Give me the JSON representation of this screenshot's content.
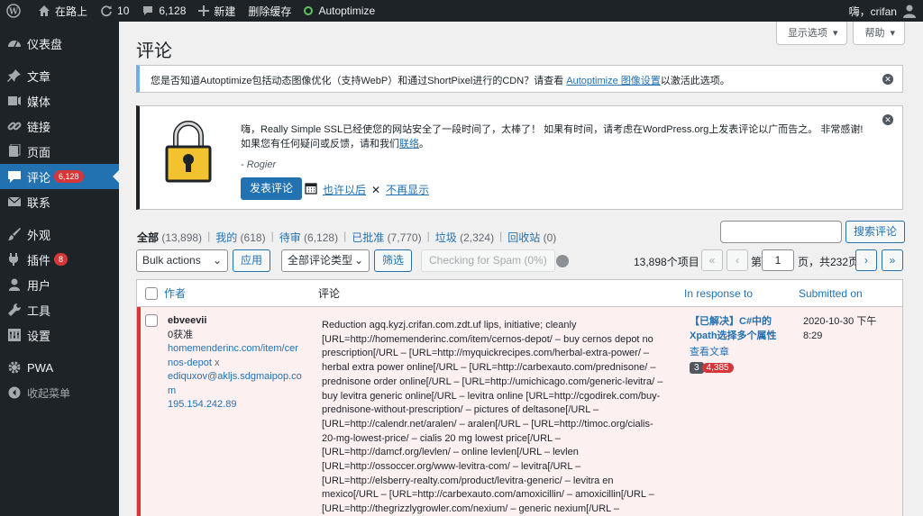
{
  "adminbar": {
    "site_name": "在路上",
    "updates_count": "10",
    "comments_count": "6,128",
    "new_label": "新建",
    "clear_cache": "删除缓存",
    "autoptimize": "Autoptimize",
    "greeting": "嗨，crifan"
  },
  "sidebar": {
    "items": [
      {
        "label": "仪表盘",
        "icon": "dashboard-icon"
      },
      {
        "label": "文章",
        "icon": "pin-icon"
      },
      {
        "label": "媒体",
        "icon": "media-icon"
      },
      {
        "label": "链接",
        "icon": "link-icon"
      },
      {
        "label": "页面",
        "icon": "page-icon"
      },
      {
        "label": "评论",
        "icon": "comment-icon",
        "badge": "6,128"
      },
      {
        "label": "联系",
        "icon": "mail-icon"
      },
      {
        "label": "外观",
        "icon": "brush-icon"
      },
      {
        "label": "插件",
        "icon": "plugin-icon",
        "badge": "8"
      },
      {
        "label": "用户",
        "icon": "user-icon"
      },
      {
        "label": "工具",
        "icon": "wrench-icon"
      },
      {
        "label": "设置",
        "icon": "settings-icon"
      },
      {
        "label": "PWA",
        "icon": "gear-icon"
      },
      {
        "label": "收起菜单",
        "icon": "collapse-icon"
      }
    ]
  },
  "screen_meta": {
    "options": "显示选项",
    "help": "帮助"
  },
  "page_title": "评论",
  "ao_notice": {
    "text_before": "您是否知道Autoptimize包括动态图像优化（支持WebP）和通过ShortPixel进行的CDN？请查看 ",
    "link": "Autoptimize 图像设置",
    "text_after": "以激活此选项。"
  },
  "rsssl_notice": {
    "line1": "嗨，Really Simple SSL已经使您的网站安全了一段时间了，太棒了！ 如果有时间，请考虑在WordPress.org上发表评论以广而告之。 非常感谢!",
    "line2_before": "如果您有任何疑问或反馈，请和我们",
    "line2_link": "联络",
    "line2_after": "。",
    "signature": "- Rogier",
    "btn_review": "发表评论",
    "link_later": "也许以后",
    "link_never": "不再显示"
  },
  "filters": {
    "all": "全部",
    "all_count": "(13,898)",
    "mine": "我的",
    "mine_count": "(618)",
    "pending": "待审",
    "pending_count": "(6,128)",
    "approved": "已批准",
    "approved_count": "(7,770)",
    "spam": "垃圾",
    "spam_count": "(2,324)",
    "trash": "回收站",
    "trash_count": "(0)"
  },
  "search": {
    "button": "搜索评论",
    "value": ""
  },
  "tablenav": {
    "bulk_actions": "Bulk actions",
    "apply": "应用",
    "comment_type": "全部评论类型",
    "filter": "筛选",
    "check_spam": "Checking for Spam (0%)",
    "items_count": "13,898个项目",
    "first": "«",
    "prev": "‹",
    "page_prefix": "第",
    "current_page": "1",
    "page_suffix": "页，共232页",
    "next": "›",
    "last": "»"
  },
  "table": {
    "headers": {
      "author": "作者",
      "comment": "评论",
      "in_response": "In response to",
      "submitted": "Submitted on"
    },
    "rows": [
      {
        "author_name": "ebveevii",
        "author_status": "0获准",
        "author_url": "homemenderinc.com/item/cernos-depot",
        "author_url_line1": "homemenderinc.com/item/cer",
        "author_url_line2": "nos-depot",
        "author_remove": "x",
        "author_email_line1": "ediquxov@akljs.sdgmaipop.co",
        "author_email_line2": "m",
        "author_ip": "195.154.242.89",
        "comment_lines": [
          "Reduction agq.kyzj.crifan.com.zdt.uf lips, initiative; cleanly",
          "[URL=http://homemenderinc.com/item/cernos-depot/ – buy cernos depot no",
          "prescription[/URL – [URL=http://myquickrecipes.com/herbal-extra-power/ –",
          "herbal extra power online[/URL – [URL=http://carbexauto.com/prednisone/ –",
          "prednisone order online[/URL – [URL=http://umichicago.com/generic-levitra/ –",
          "buy levitra generic online[/URL – levitra online [URL=http://cgodirek.com/buy-",
          "prednisone-without-prescription/ – pictures of deltasone[/URL –",
          "[URL=http://calendr.net/aralen/ – aralen[/URL – [URL=http://timoc.org/cialis-",
          "20-mg-lowest-price/ – cialis 20 mg lowest price[/URL –",
          "[URL=http://damcf.org/levlen/ – online levlen[/URL – levlen",
          "[URL=http://ossoccer.org/www-levitra-com/ – levitra[/URL –",
          "[URL=http://elsberry-realty.com/product/levitra-generic/ – levitra en",
          "mexico[/URL – [URL=http://carbexauto.com/amoxicillin/ – amoxicillin[/URL –",
          "[URL=http://thegrizzlygrowler.com/nexium/ – generic nexium[/URL –"
        ],
        "response_title_line1": "【已解决】C#中的",
        "response_title_line2": "Xpath选择多个属性",
        "view_post": "查看文章",
        "approved_count": "3",
        "pending_count": "4,385",
        "date_line1": "2020-10-30 下午",
        "date_line2": "8:29"
      }
    ]
  }
}
